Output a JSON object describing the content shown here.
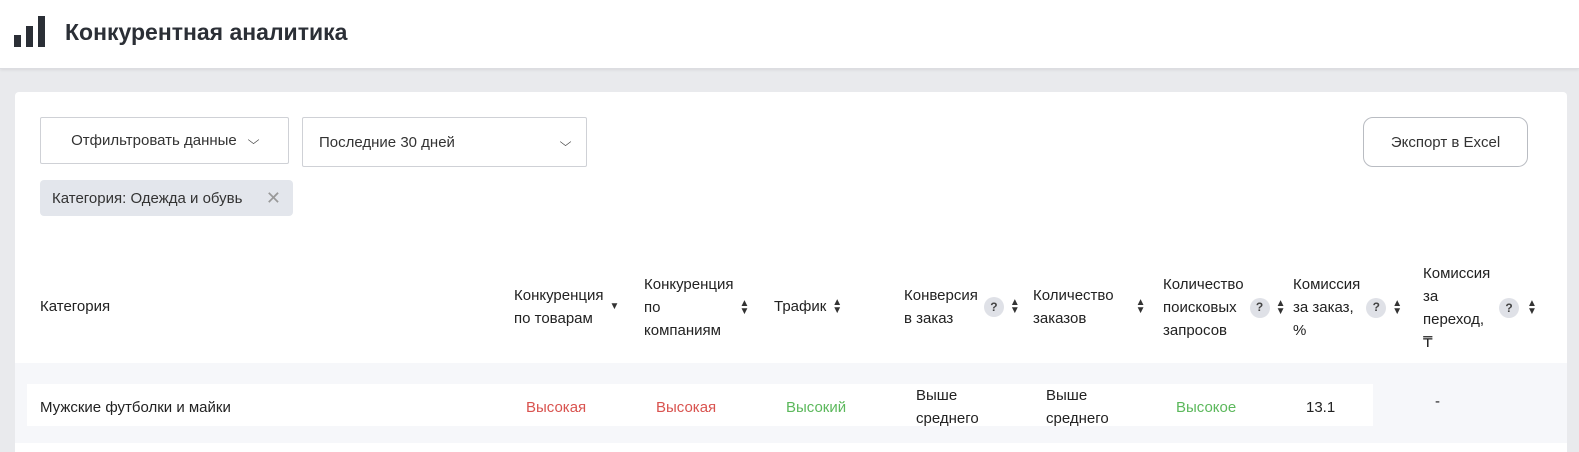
{
  "header": {
    "title": "Конкурентная аналитика",
    "icon": "bar-chart-icon"
  },
  "toolbar": {
    "filter_label": "Отфильтровать данные",
    "period_value": "Последние 30 дней",
    "export_label": "Экспорт в Excel"
  },
  "chips": [
    {
      "label": "Категория: Одежда и обувь"
    }
  ],
  "table": {
    "columns": {
      "category": "Категория",
      "product_comp": [
        "Конкуренция",
        "по товарам"
      ],
      "company_comp": [
        "Конкуренция",
        "по",
        "компаниям"
      ],
      "traffic": "Трафик",
      "conversion": [
        "Конверсия",
        "в заказ"
      ],
      "orders": [
        "Количество",
        "заказов"
      ],
      "searches": [
        "Количество",
        "поисковых",
        "запросов"
      ],
      "commission_order": [
        "Комиссия",
        "за заказ,",
        "%"
      ],
      "commission_click": [
        "Комиссия",
        "за",
        "переход,",
        "₸"
      ]
    },
    "help_glyph": "?",
    "rows": [
      {
        "category": "Мужские футболки и майки",
        "product_comp": "Высокая",
        "company_comp": "Высокая",
        "traffic": "Высокий",
        "conversion": [
          "Выше",
          "среднего"
        ],
        "orders": [
          "Выше",
          "среднего"
        ],
        "searches": "Высокое",
        "commission_order": "13.1",
        "commission_click": "-"
      }
    ]
  },
  "colors": {
    "high_red": "#d9534f",
    "high_green": "#5cb85c",
    "chip_bg": "#e3e6ec"
  }
}
